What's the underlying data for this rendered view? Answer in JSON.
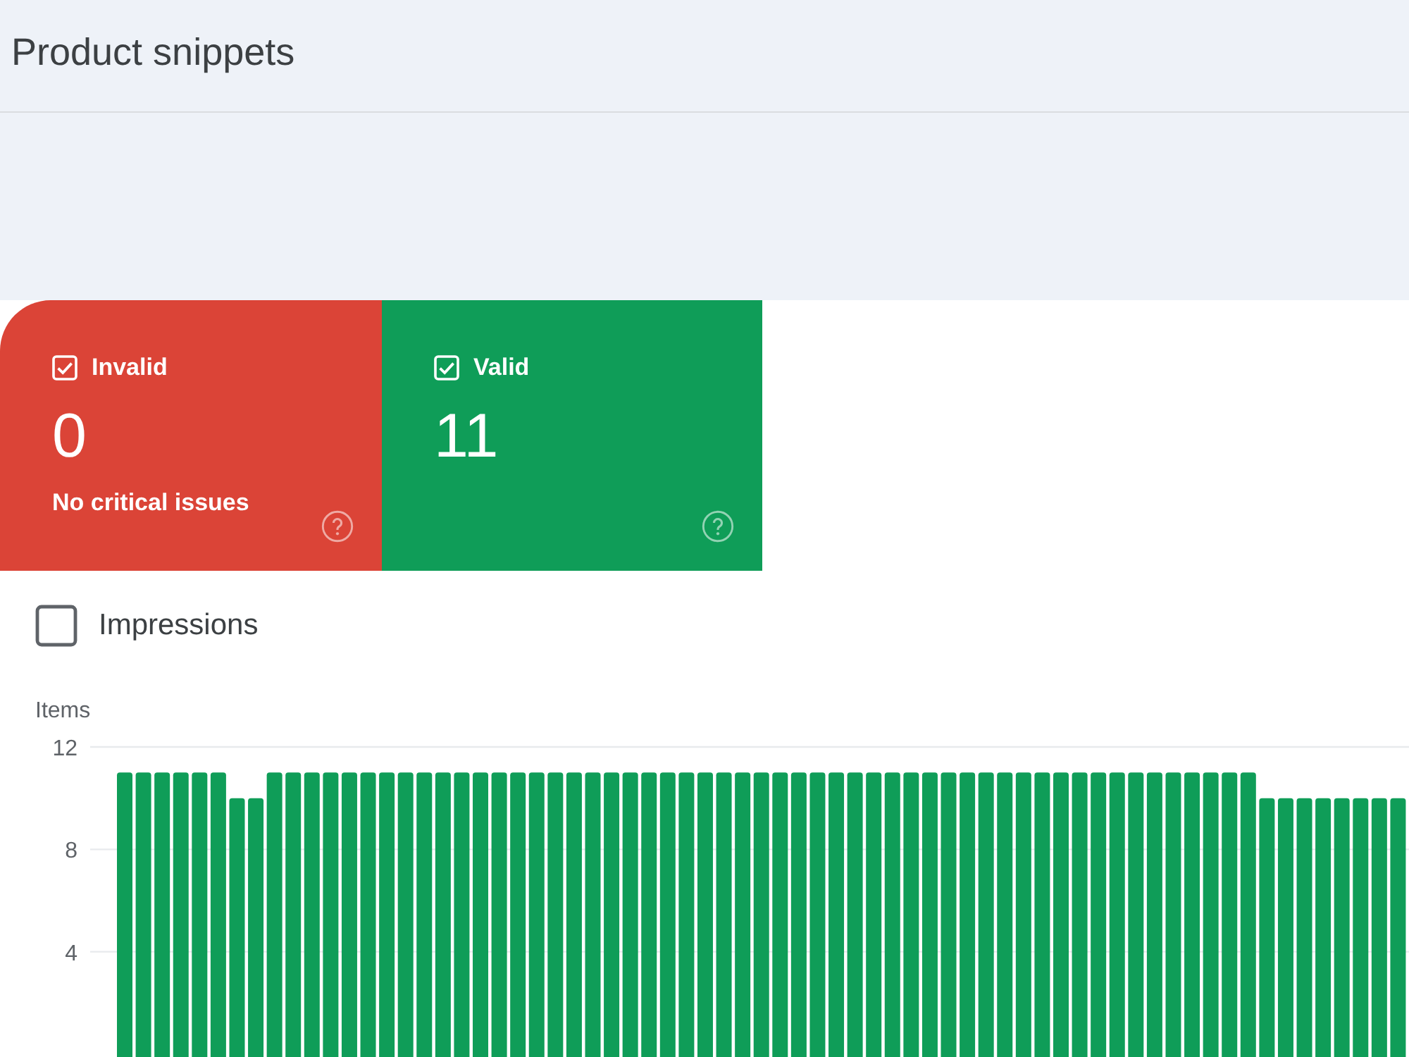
{
  "header": {
    "title": "Product snippets"
  },
  "summary_cards": [
    {
      "label": "Invalid",
      "checked": true,
      "count": "0",
      "note": "No critical issues",
      "color": "#db4437"
    },
    {
      "label": "Valid",
      "checked": true,
      "count": "11",
      "color": "#0f9d58"
    }
  ],
  "impressions": {
    "label": "Impressions",
    "checked": false
  },
  "chart": {
    "chart_data": [
      {
        "type": "bar",
        "ylabel": "Items",
        "values": [
          11,
          11,
          11,
          11,
          11,
          11,
          10,
          10,
          11,
          11,
          11,
          11,
          11,
          11,
          11,
          11,
          11,
          11,
          11,
          11,
          11,
          11,
          11,
          11,
          11,
          11,
          11,
          11,
          11,
          11,
          11,
          11,
          11,
          11,
          11,
          11,
          11,
          11,
          11,
          11,
          11,
          11,
          11,
          11,
          11,
          11,
          11,
          11,
          11,
          11,
          11,
          11,
          11,
          11,
          11,
          11,
          11,
          11,
          11,
          11,
          11,
          10,
          10,
          10,
          10,
          10,
          10,
          10,
          10
        ],
        "color": "#0f9d58",
        "ylim": [
          0,
          12
        ],
        "yticks": [
          4,
          8,
          12
        ],
        "grid": true
      }
    ]
  }
}
